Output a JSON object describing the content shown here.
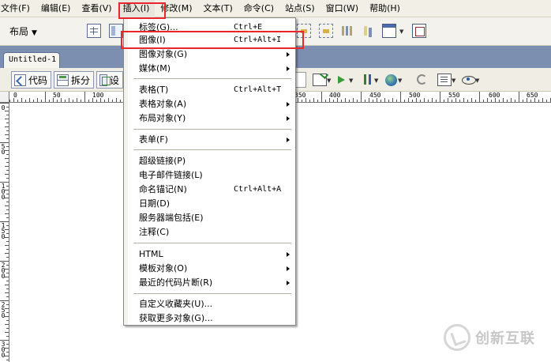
{
  "menubar": {
    "items": [
      "文件(F)",
      "编辑(E)",
      "查看(V)",
      "插入(I)",
      "修改(M)",
      "文本(T)",
      "命令(C)",
      "站点(S)",
      "窗口(W)",
      "帮助(H)"
    ]
  },
  "insertbar": {
    "category": "布局"
  },
  "document": {
    "tab": "Untitled-1"
  },
  "doctoolbar": {
    "code": "代码",
    "split": "拆分",
    "design": "设"
  },
  "ruler": {
    "h_labels": [
      "0",
      "50",
      "100",
      "350",
      "400",
      "450",
      "500",
      "550",
      "600",
      "650"
    ],
    "v_labels": [
      "0",
      "50",
      "100",
      "150",
      "200",
      "250",
      "300"
    ]
  },
  "insert_menu": {
    "items": [
      {
        "label": "标签(G)...",
        "shortcut": "Ctrl+E"
      },
      {
        "label": "图像(I)",
        "shortcut": "Ctrl+Alt+I"
      },
      {
        "label": "图像对象(G)",
        "shortcut": ""
      },
      {
        "label": "媒体(M)",
        "shortcut": ""
      },
      {
        "label": "表格(T)",
        "shortcut": "Ctrl+Alt+T"
      },
      {
        "label": "表格对象(A)",
        "shortcut": ""
      },
      {
        "label": "布局对象(Y)",
        "shortcut": ""
      },
      {
        "label": "表单(F)",
        "shortcut": ""
      },
      {
        "label": "超级链接(P)",
        "shortcut": ""
      },
      {
        "label": "电子邮件链接(L)",
        "shortcut": ""
      },
      {
        "label": "命名锚记(N)",
        "shortcut": "Ctrl+Alt+A"
      },
      {
        "label": "日期(D)",
        "shortcut": ""
      },
      {
        "label": "服务器端包括(E)",
        "shortcut": ""
      },
      {
        "label": "注释(C)",
        "shortcut": ""
      },
      {
        "label": "HTML",
        "shortcut": ""
      },
      {
        "label": "模板对象(O)",
        "shortcut": ""
      },
      {
        "label": "最近的代码片断(R)",
        "shortcut": ""
      },
      {
        "label": "自定义收藏夹(U)...",
        "shortcut": ""
      },
      {
        "label": "获取更多对象(G)...",
        "shortcut": ""
      }
    ]
  },
  "watermark": {
    "text": "创新互联"
  },
  "colors": {
    "highlight": "#e8262c",
    "tab_strip": "#7d8fb0"
  }
}
